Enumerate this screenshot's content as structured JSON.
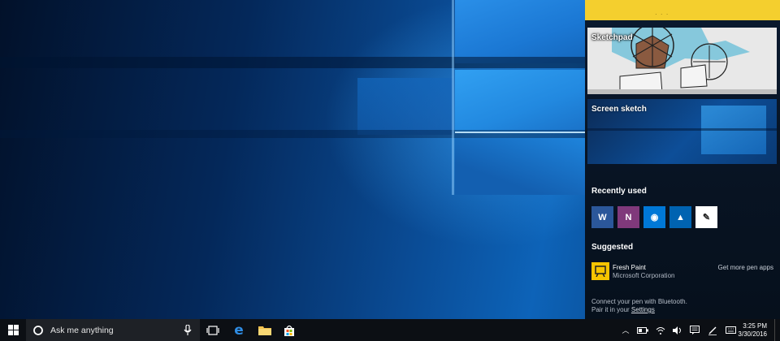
{
  "workspace": {
    "tiles": [
      {
        "label": "Sketchpad"
      },
      {
        "label": "Screen sketch"
      }
    ],
    "recently_used": {
      "heading": "Recently used",
      "apps": [
        {
          "icon": "word-icon",
          "glyph": "W",
          "color": "#2b579a"
        },
        {
          "icon": "onenote-icon",
          "glyph": "N",
          "color": "#80397b"
        },
        {
          "icon": "maps-icon",
          "glyph": "◉",
          "color": "#0078d7"
        },
        {
          "icon": "photos-icon",
          "glyph": "▲",
          "color": "#0063b1"
        },
        {
          "icon": "pen-app-icon",
          "glyph": "✎",
          "color": "#ffffff"
        }
      ]
    },
    "suggested": {
      "heading": "Suggested",
      "app_name": "Fresh Paint",
      "publisher": "Microsoft Corporation",
      "get_more": "Get more pen apps"
    },
    "bluetooth_line1": "Connect your pen with Bluetooth.",
    "bluetooth_line2_prefix": "Pair it in your",
    "settings_link": "Settings"
  },
  "taskbar": {
    "search_placeholder": "Ask me anything",
    "time": "3:25 PM",
    "date": "3/30/2016",
    "accent_color": "#0078d7"
  }
}
